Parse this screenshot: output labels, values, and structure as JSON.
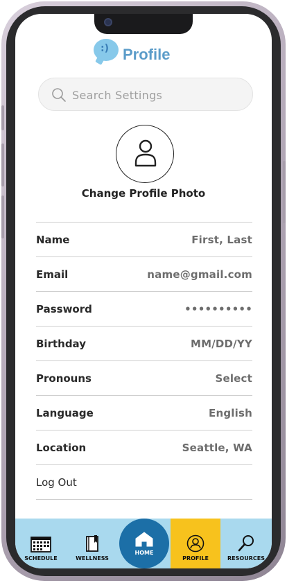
{
  "header": {
    "logo_face": ":)",
    "title": "Profile"
  },
  "search": {
    "placeholder": "Search Settings"
  },
  "profile_photo": {
    "label": "Change Profile Photo"
  },
  "settings": [
    {
      "label": "Name",
      "value": "First, Last"
    },
    {
      "label": "Email",
      "value": "name@gmail.com"
    },
    {
      "label": "Password",
      "value": "••••••••••"
    },
    {
      "label": "Birthday",
      "value": "MM/DD/YY"
    },
    {
      "label": "Pronouns",
      "value": "Select"
    },
    {
      "label": "Language",
      "value": "English"
    },
    {
      "label": "Location",
      "value": "Seattle, WA"
    }
  ],
  "logout_label": "Log Out",
  "nav": {
    "schedule": "SCHEDULE",
    "wellness": "WELLNESS",
    "home": "HOME",
    "profile": "PROFILE",
    "resources": "RESOURCES"
  },
  "colors": {
    "title": "#5b9cc9",
    "nav_bg": "#a9d9ee",
    "home_bg": "#1c6fa7",
    "active_tab": "#f7c21d"
  },
  "icons": {
    "logo": "smile-bubble-icon",
    "search": "search-icon",
    "avatar": "person-icon",
    "schedule": "calendar-icon",
    "wellness": "notebook-icon",
    "home": "house-icon",
    "profile": "person-circle-icon",
    "resources": "magnifier-icon"
  }
}
